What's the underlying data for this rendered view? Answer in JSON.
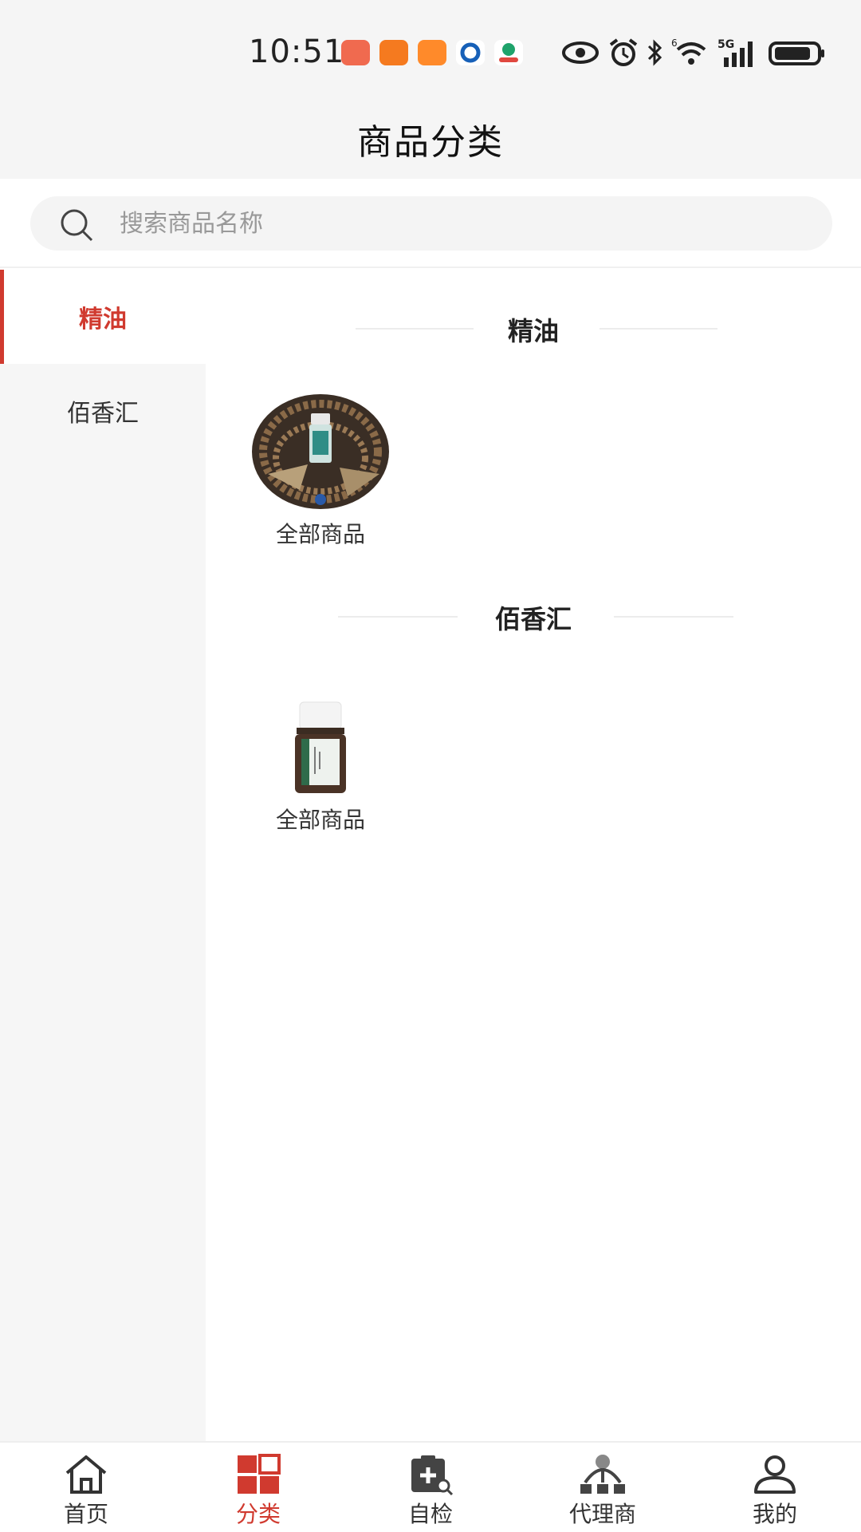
{
  "status_bar": {
    "time": "10:51",
    "network": "5G",
    "wifi_badge": "6"
  },
  "header": {
    "title": "商品分类"
  },
  "search": {
    "placeholder": "搜索商品名称"
  },
  "sidebar": {
    "items": [
      {
        "label": "精油",
        "active": true
      },
      {
        "label": "佰香汇",
        "active": false
      }
    ]
  },
  "sections": [
    {
      "title": "精油",
      "products": [
        {
          "label": "全部商品",
          "image": "essential-oil-bottle-with-beads"
        }
      ]
    },
    {
      "title": "佰香汇",
      "products": [
        {
          "label": "全部商品",
          "image": "essential-oil-bottle"
        }
      ]
    }
  ],
  "tabbar": {
    "tabs": [
      {
        "label": "首页",
        "icon": "home-icon"
      },
      {
        "label": "分类",
        "icon": "category-icon",
        "active": true
      },
      {
        "label": "自检",
        "icon": "self-check-icon"
      },
      {
        "label": "代理商",
        "icon": "agent-icon"
      },
      {
        "label": "我的",
        "icon": "profile-icon"
      }
    ]
  },
  "colors": {
    "accent": "#d03a2f",
    "header_bg": "#f5f5f5",
    "sidebar_bg": "#f6f6f6"
  }
}
